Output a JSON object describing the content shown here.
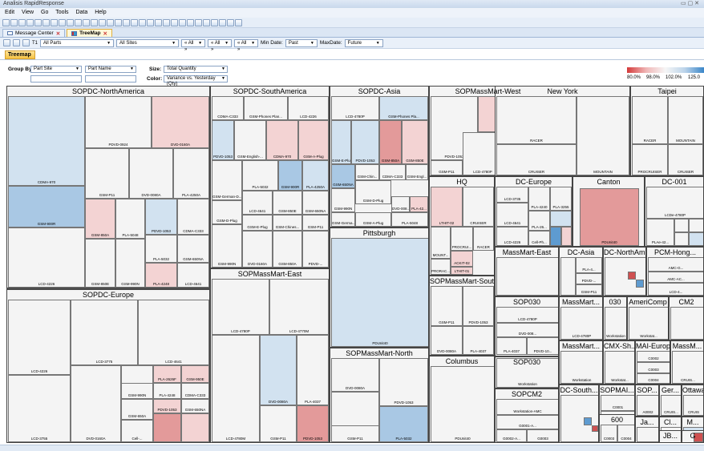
{
  "window": {
    "title": "Analisis RapidResponse",
    "controls": "▭ ▢ ✕"
  },
  "menu": [
    "Edit",
    "View",
    "Go",
    "Tools",
    "Data",
    "Help"
  ],
  "tabs": [
    {
      "label": "Message Center"
    },
    {
      "label": "TreeMap",
      "active": true
    }
  ],
  "filter_bar": {
    "part_filter": "All Parts",
    "site_filter": "All Sites",
    "all1": "« All »",
    "all2": "« All »",
    "all3": "« All »",
    "min_date_label": "Min Date:",
    "min_date": "Past",
    "max_date_label": "MaxDate:",
    "max_date": "Future"
  },
  "view_tab": "Treemap",
  "controls": {
    "group_by_label": "Group By:",
    "group_by_1": "Part Site",
    "group_by_2": "Part Name",
    "size_label": "Size:",
    "size_value": "Total Quantity",
    "color_label": "Color:",
    "color_value": "Variance vs. Yesterday (Qty)"
  },
  "legend": {
    "ticks": [
      "80.0%",
      "98.0%",
      "102.0%",
      "125.0"
    ],
    "colors": {
      "low": "#d43a3a",
      "mid": "#f6f6f6",
      "high": "#3a86c8"
    }
  },
  "groups": [
    {
      "name": "SOPDC-NorthAmerica"
    },
    {
      "name": "SOPDC-SouthAmerica"
    },
    {
      "name": "SOPDC-Asia"
    },
    {
      "name": "SOPMassMart-West"
    },
    {
      "name": "New York"
    },
    {
      "name": "Taipei"
    },
    {
      "name": "SOPDC-Europe"
    },
    {
      "name": "SOPMassMart-East"
    },
    {
      "name": "Pittsburgh"
    },
    {
      "name": "HQ"
    },
    {
      "name": "DC-Europe"
    },
    {
      "name": "Canton"
    },
    {
      "name": "DC-001"
    },
    {
      "name": "SOPMassMart-North"
    },
    {
      "name": "Columbus"
    },
    {
      "name": "SOPMassMart-South"
    },
    {
      "name": "MassMart-East"
    },
    {
      "name": "DC-Asia"
    },
    {
      "name": "DC-NorthAm..."
    },
    {
      "name": "PCM-Hong..."
    },
    {
      "name": "SOP030"
    },
    {
      "name": "MassMart..."
    },
    {
      "name": "030"
    },
    {
      "name": "AmeriComp"
    },
    {
      "name": "CM2"
    },
    {
      "name": "MassMart..."
    },
    {
      "name": "CMX-Sh..."
    },
    {
      "name": "MAI-Europe"
    },
    {
      "name": "MassM..."
    },
    {
      "name": "SOPCM2"
    },
    {
      "name": "DC-South..."
    },
    {
      "name": "SOPMAI..."
    },
    {
      "name": "SOP..."
    },
    {
      "name": "Ger..."
    },
    {
      "name": "Ottawa"
    },
    {
      "name": "600"
    },
    {
      "name": "Ja..."
    },
    {
      "name": "Cl..."
    },
    {
      "name": "M..."
    },
    {
      "name": "JB..."
    },
    {
      "name": "G"
    }
  ],
  "leaves": {
    "na": [
      "CDMA-970",
      "GSM-900R",
      "LCD-4226",
      "PDVD-0924",
      "DVD-0160A",
      "GSM-P11",
      "DVD-0080A",
      "PLA-4250A",
      "GSM-850A",
      "PLA-5048",
      "PDVD-1053",
      "CDMA-C333",
      "PLA-5032",
      "GSM-650NA",
      "GSM-850E",
      "GSM-990N",
      "PLA-4248",
      "LCD-4641"
    ],
    "sa": [
      "CDMA-C333",
      "GSM-Phones Plan...",
      "LCD-4226",
      "PDVD-1053",
      "GSM-English-...",
      "CDMA-970",
      "GSM-A-Plug",
      "GSM-German-D...",
      "PLA-5032",
      "GSM-900R",
      "PLA-4250A",
      "LCD-4641",
      "GSM-850E",
      "GSM-650NA",
      "GSM-D-Plug",
      "GSM-E-Plug",
      "GSM-Chines...",
      "GSM-P11",
      "GSM-990N",
      "DVD-0160A",
      "GSM-850A",
      "PDVD-..."
    ],
    "asia": [
      "LCD-4780P",
      "GSM-Phones Pla...",
      "GSM-E-Plug",
      "PDVD-1053",
      "GSM-850A",
      "GSM-850E",
      "GSM-650NA",
      "GSM-Chin...",
      "CDMA-C333",
      "GSM-Engl...",
      "GSM-990N",
      "GSM-D-Plug",
      "DVD-008...",
      "PLA-42...",
      "GSM-Germa...",
      "GSM-A-Plug",
      "PLA-5048"
    ],
    "eu": [
      "LCD-4226",
      "LCD-3755",
      "LCD-3775",
      "LCD-4641",
      "DVD-0160A",
      "PLA-3255",
      "PLA-2626F",
      "GSM-950E",
      "GSM-990N",
      "PLA-4248",
      "CDMA-C333",
      "GSM-650A",
      "PDVD-1053",
      "GSM-650NA",
      "Cell-..."
    ],
    "mme": [
      "LCD-4780P",
      "LCD-4770M",
      "LCD-4780M",
      "DVD-0080A",
      "PLA-4037",
      "GSM-P11",
      "PDVD-1053"
    ],
    "mmw": [
      "DVD-0080A",
      "PDVD-1053",
      "GSM-P11",
      "LCD-4780P",
      "PLA-5032"
    ],
    "ny": [
      "RACER",
      "CRUISER",
      "MOUNTAIN"
    ],
    "taipei": [
      "RACER",
      "MOUNTAIN",
      "PROCRUISER",
      "CRUISER"
    ],
    "pitt": [
      "PDUnit40"
    ],
    "hq": [
      "LTHIT-02",
      "CRUISER",
      "PROCRUI...",
      "RACER",
      "MOUNT...",
      "ACKIT-02",
      "PRORAC...",
      "LTHIT-01"
    ],
    "dceu": [
      "LCD-3735",
      "PLA-4240",
      "PLA-3255",
      "LCD-4641",
      "PLA-26...",
      "LCD-4226",
      "Cell-Ph..."
    ],
    "canton": [
      "PDUnit40"
    ],
    "dc001": [
      "LCDe-4780P",
      "PLAe-42..."
    ],
    "mmn": [
      "DVD-0080A",
      "LCD-4780P",
      "PDVD-1053",
      "GSM-P11",
      "PLA-5032"
    ],
    "columbus": [
      "PDUnit40"
    ],
    "mms": [
      "GSM-P11",
      "PDVD-1053",
      "PLA-4037",
      "DVD-0080A",
      "LCD-4780P"
    ],
    "misc": [
      "LCD-4780P",
      "DVD-008...",
      "PLA-4037",
      "PDVD-10...",
      "Workstation",
      "Server",
      "Gamer",
      "Workstation-AMC",
      "G0001-A...",
      "G0002-A...",
      "G0003",
      "C0001",
      "C0002",
      "C0003",
      "C0004",
      "Server",
      "Workstat...",
      "AMC-Worstat...",
      "AMC-G...",
      "AMC-AC...",
      "LCD-4...",
      "PLA-4...",
      "PDVD-...",
      "GSM-P11",
      "CRUIS...",
      "CRUIS",
      "A0001",
      "A0002",
      "C0001",
      "C0002",
      "C0003",
      "C0004"
    ]
  }
}
